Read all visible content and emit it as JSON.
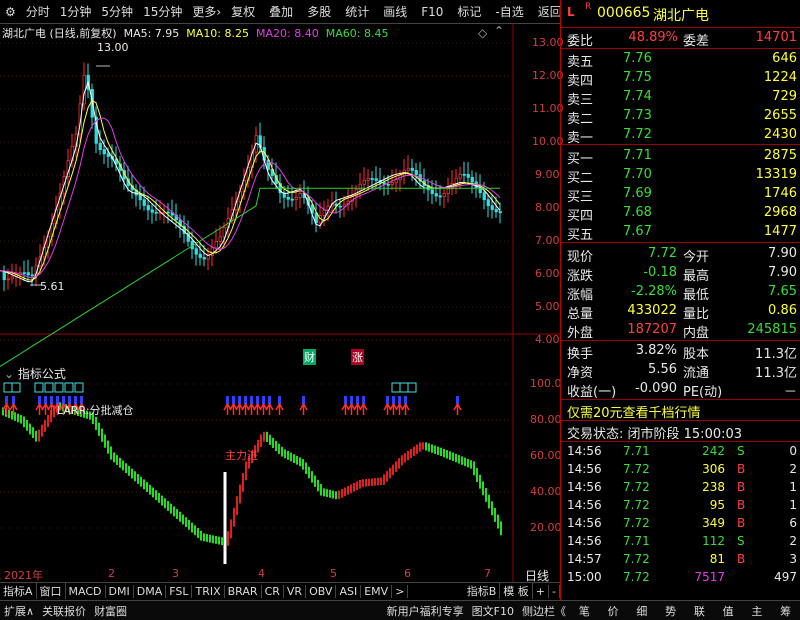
{
  "toolbar": {
    "items": [
      "分时",
      "1分钟",
      "5分钟",
      "15分钟",
      "更多›"
    ],
    "right_items": [
      "复权",
      "叠加",
      "多股",
      "统计",
      "画线",
      "F10",
      "标记",
      "-自选",
      "返回"
    ]
  },
  "main_chart": {
    "title": "湖北广电 (日线,前复权)",
    "ma5": "MA5: 7.95",
    "ma10": "MA10: 8.25",
    "ma20": "MA20: 8.40",
    "ma60": "MA60: 8.45",
    "high_label": "13.00",
    "low_label": "5.61",
    "y_ticks": [
      "13.00",
      "12.00",
      "11.00",
      "10.00",
      "9.00",
      "8.00",
      "7.00",
      "6.00",
      "5.00",
      "4.00"
    ],
    "marker_cai": "财",
    "marker_zhang": "涨"
  },
  "indicator": {
    "title": "指标公式",
    "larr_label": "LARR:分批减仓",
    "zhuli_label": "主力进",
    "y_ticks": [
      "100.0",
      "80.00",
      "60.00",
      "40.00",
      "20.00"
    ]
  },
  "x_axis": {
    "year": "2021年",
    "months": [
      "2",
      "3",
      "4",
      "5",
      "6",
      "7"
    ],
    "right_label": "日线"
  },
  "bottom_tabs": [
    "指标A",
    "窗口",
    "MACD",
    "DMI",
    "DMA",
    "FSL",
    "TRIX",
    "BRAR",
    "CR",
    "VR",
    "OBV",
    "ASI",
    "EMV",
    ">",
    "指标B",
    "模 板",
    "+",
    "-"
  ],
  "bottom_bar": {
    "left": [
      "扩展∧",
      "关联报价",
      "财富圈"
    ],
    "center": "新用户福利专享",
    "right1": "图文F10",
    "right2": "侧边栏《"
  },
  "quote": {
    "code": "000665",
    "name": "湖北广电",
    "weibi_label": "委比",
    "weibi_value": "48.89%",
    "weicha_label": "委差",
    "weicha_value": "14701",
    "sell": [
      {
        "label": "卖五",
        "price": "7.76",
        "vol": "646"
      },
      {
        "label": "卖四",
        "price": "7.75",
        "vol": "1224"
      },
      {
        "label": "卖三",
        "price": "7.74",
        "vol": "729"
      },
      {
        "label": "卖二",
        "price": "7.73",
        "vol": "2655"
      },
      {
        "label": "卖一",
        "price": "7.72",
        "vol": "2430"
      }
    ],
    "buy": [
      {
        "label": "买一",
        "price": "7.71",
        "vol": "2875"
      },
      {
        "label": "买二",
        "price": "7.70",
        "vol": "13319"
      },
      {
        "label": "买三",
        "price": "7.69",
        "vol": "1746"
      },
      {
        "label": "买四",
        "price": "7.68",
        "vol": "2968"
      },
      {
        "label": "买五",
        "price": "7.67",
        "vol": "1477"
      }
    ],
    "stats": [
      {
        "l1": "现价",
        "v1": "7.72",
        "c1": "grn",
        "l2": "今开",
        "v2": "7.90",
        "c2": "wht"
      },
      {
        "l1": "涨跌",
        "v1": "-0.18",
        "c1": "grn",
        "l2": "最高",
        "v2": "7.90",
        "c2": "wht"
      },
      {
        "l1": "涨幅",
        "v1": "-2.28%",
        "c1": "grn",
        "l2": "最低",
        "v2": "7.65",
        "c2": "grn"
      },
      {
        "l1": "总量",
        "v1": "433022",
        "c1": "yel",
        "l2": "量比",
        "v2": "0.86",
        "c2": "yel"
      },
      {
        "l1": "外盘",
        "v1": "187207",
        "c1": "red",
        "l2": "内盘",
        "v2": "245815",
        "c2": "grn"
      }
    ],
    "stats2": [
      {
        "l1": "换手",
        "v1": "3.82%",
        "l2": "股本",
        "v2": "11.3亿"
      },
      {
        "l1": "净资",
        "v1": "5.56",
        "l2": "流通",
        "v2": "11.3亿"
      },
      {
        "l1": "收益(一)",
        "v1": "-0.090",
        "l2": "PE(动)",
        "v2": "－"
      }
    ],
    "promo": "仅需20元查看千档行情",
    "status": "交易状态: 闭市阶段 15:00:03",
    "ticks": [
      {
        "t": "14:56",
        "p": "7.71",
        "v": "242",
        "s": "S",
        "c": "0"
      },
      {
        "t": "14:56",
        "p": "7.72",
        "v": "306",
        "s": "B",
        "c": "2"
      },
      {
        "t": "14:56",
        "p": "7.72",
        "v": "238",
        "s": "B",
        "c": "1"
      },
      {
        "t": "14:56",
        "p": "7.72",
        "v": "95",
        "s": "B",
        "c": "1"
      },
      {
        "t": "14:56",
        "p": "7.72",
        "v": "349",
        "s": "B",
        "c": "6"
      },
      {
        "t": "14:56",
        "p": "7.71",
        "v": "112",
        "s": "S",
        "c": "2"
      },
      {
        "t": "14:57",
        "p": "7.72",
        "v": "81",
        "s": "B",
        "c": "3"
      },
      {
        "t": "15:00",
        "p": "7.72",
        "v": "7517",
        "s": "",
        "c": "497"
      }
    ],
    "side_tabs": [
      "笔",
      "价",
      "细",
      "势",
      "联",
      "值",
      "主",
      "筹"
    ]
  }
}
